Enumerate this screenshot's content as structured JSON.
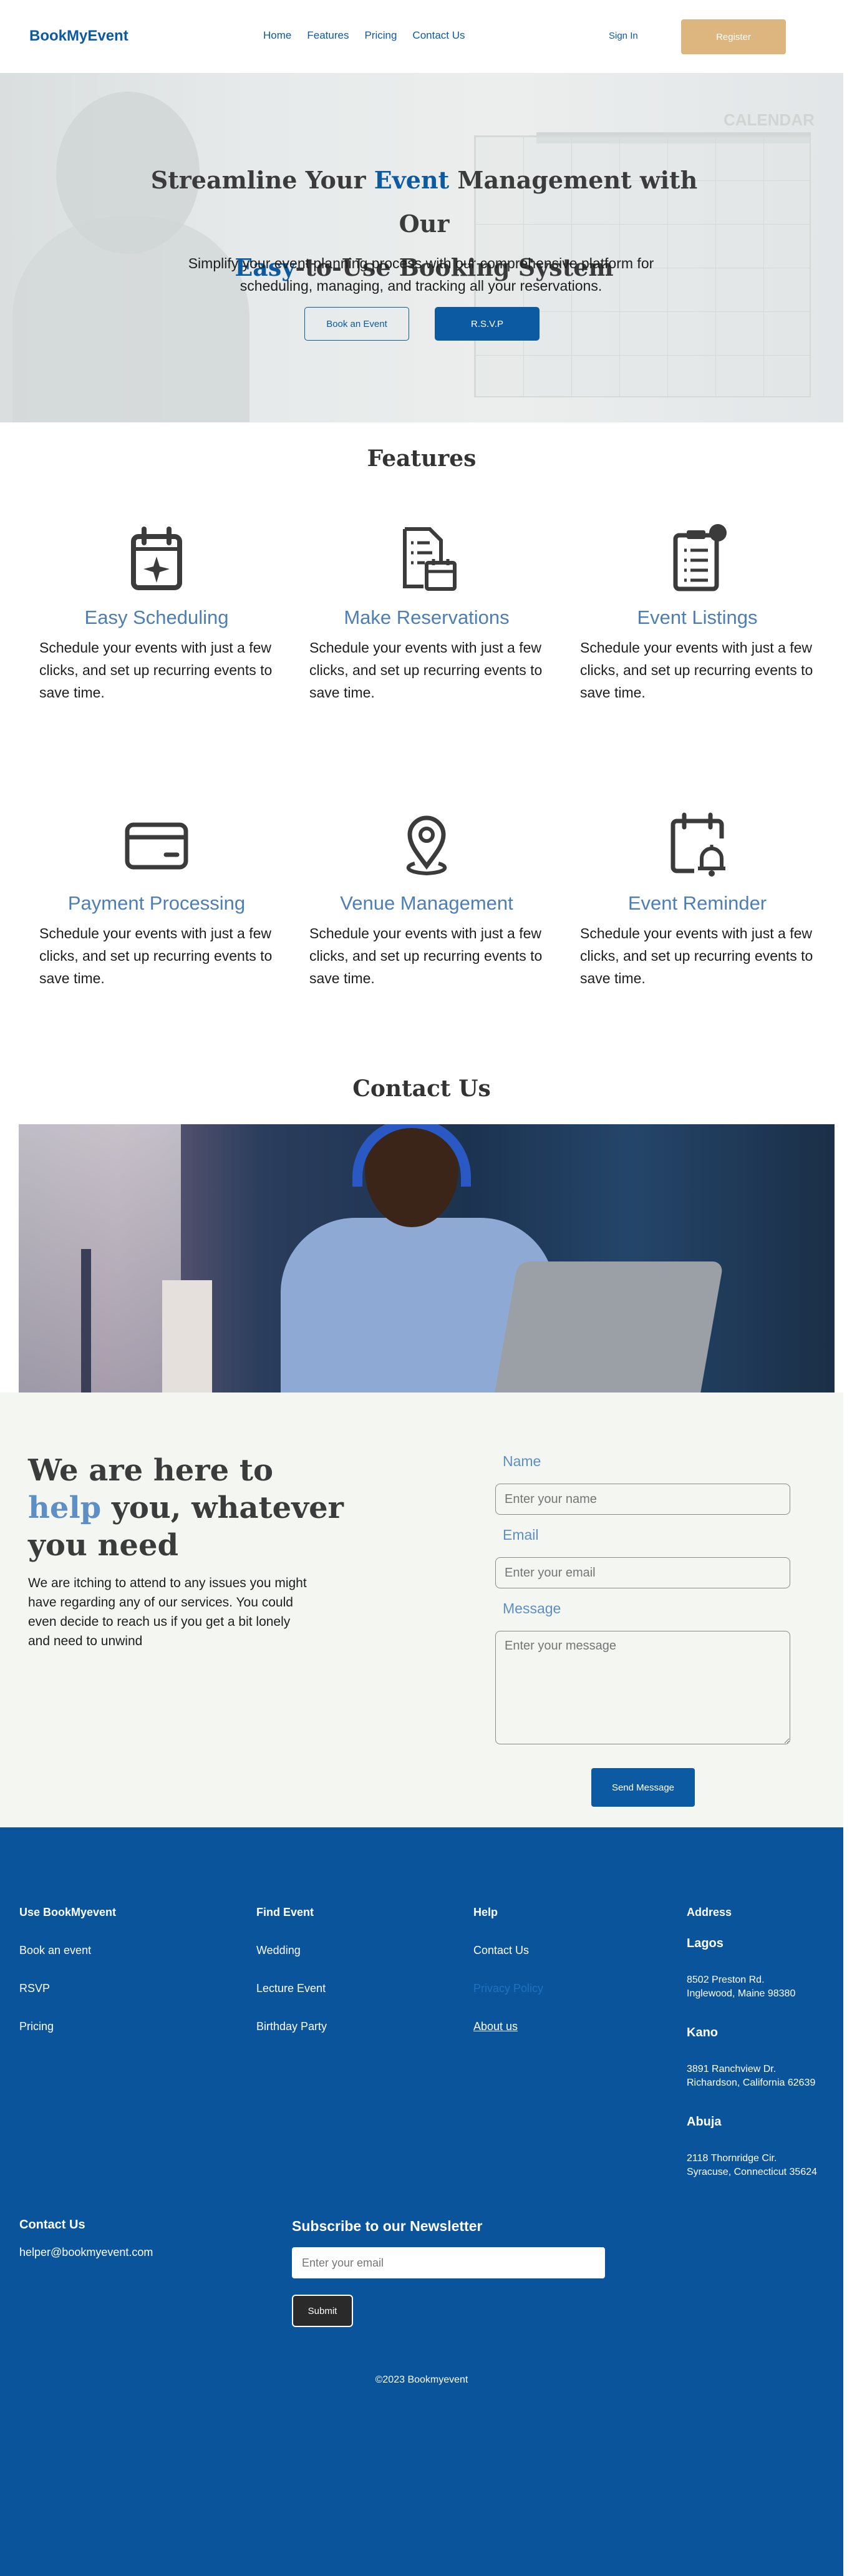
{
  "nav": {
    "brand": "BookMyEvent",
    "links": [
      "Home",
      "Features",
      "Pricing",
      "Contact Us"
    ],
    "signin": "Sign In",
    "register": "Register"
  },
  "hero": {
    "title_part1": "Streamline Your ",
    "title_hl1": "Event",
    "title_part2": " Management with Our ",
    "title_hl2": "Easy",
    "title_part3": "-to-Use Booking System",
    "subtitle": "Simplify your event planning process with our comprehensive platform for scheduling, managing, and tracking all your reservations.",
    "btn_book": "Book an Event",
    "btn_rsvp": "R.S.V.P",
    "calendar_word": "CALENDAR"
  },
  "features": {
    "title": "Features",
    "items": [
      {
        "icon": "calendar-star-icon",
        "title": "Easy Scheduling",
        "desc": "Schedule your events with just a few clicks, and set up recurring events to save time."
      },
      {
        "icon": "documents-calendar-icon",
        "title": "Make Reservations",
        "desc": "Schedule your events with just a few clicks, and set up recurring events to save time."
      },
      {
        "icon": "listing-document-icon",
        "title": "Event Listings",
        "desc": "Schedule your events with just a few clicks, and set up recurring events to save time."
      },
      {
        "icon": "credit-card-icon",
        "title": "Payment Processing",
        "desc": "Schedule your events with just a few clicks, and set up recurring events to save time."
      },
      {
        "icon": "location-pin-icon",
        "title": "Venue Management",
        "desc": "Schedule your events with just a few clicks, and set up recurring events to save time."
      },
      {
        "icon": "calendar-bell-icon",
        "title": "Event Reminder",
        "desc": "Schedule your events with just a few clicks, and set up recurring events to save time."
      }
    ]
  },
  "contact": {
    "title": "Contact Us",
    "head_part1": "We are here to ",
    "head_hl": "help",
    "head_part2": " you, whatever you need",
    "desc": "We are itching to attend to any issues you might have regarding any of our services. You could even decide to reach us if you get a bit lonely and need to unwind",
    "name_label": "Name",
    "name_placeholder": "Enter your name",
    "email_label": "Email",
    "email_placeholder": "Enter your email",
    "message_label": "Message",
    "message_placeholder": "Enter your message",
    "send": "Send Message"
  },
  "footer": {
    "col1": {
      "title": "Use BookMyevent",
      "items": [
        "Book an event",
        "RSVP",
        "Pricing"
      ]
    },
    "col2": {
      "title": "Find Event",
      "items": [
        "Wedding",
        "Lecture Event",
        "Birthday Party"
      ]
    },
    "col3": {
      "title": "Help",
      "items": [
        "Contact Us",
        "Privacy Policy",
        "About us"
      ]
    },
    "address": {
      "title": "Address",
      "cities": [
        {
          "name": "Lagos",
          "line1": "8502 Preston Rd.",
          "line2": "Inglewood, Maine 98380"
        },
        {
          "name": "Kano",
          "line1": "3891 Ranchview Dr.",
          "line2": "Richardson, California 62639"
        },
        {
          "name": "Abuja",
          "line1": "2118 Thornridge Cir.",
          "line2": "Syracuse, Connecticut 35624"
        }
      ]
    },
    "contact_title": "Contact Us",
    "contact_email": "helper@bookmyevent.com",
    "newsletter_title": "Subscribe to our Newsletter",
    "newsletter_placeholder": "Enter your email",
    "newsletter_submit": "Submit",
    "copyright": "©2023 Bookmyevent"
  },
  "colors": {
    "brand": "#0b5aa2",
    "accent": "#ddb57e",
    "feature_title": "#4d7fb5",
    "footer_bg": "#0a549c"
  }
}
